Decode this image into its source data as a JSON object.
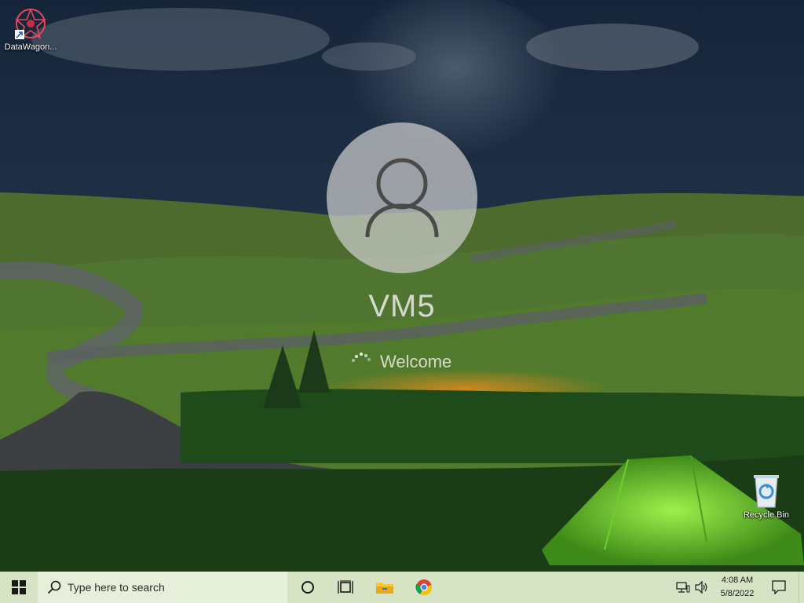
{
  "desktop": {
    "icons": [
      {
        "label": "DataWagon...",
        "icon": "datawagon-app-icon"
      },
      {
        "label": "Recycle Bin",
        "icon": "recycle-bin-icon"
      }
    ]
  },
  "lock_screen": {
    "username": "VM5",
    "status": "Welcome"
  },
  "taskbar": {
    "start_icon": "windows-logo-icon",
    "search_placeholder": "Type here to search",
    "pinned": [
      {
        "name": "cortana",
        "icon": "circle-icon"
      },
      {
        "name": "task-view",
        "icon": "task-view-icon"
      },
      {
        "name": "file-explorer",
        "icon": "folder-icon"
      },
      {
        "name": "chrome",
        "icon": "chrome-icon"
      }
    ],
    "tray": {
      "network_icon": "network-icon",
      "volume_icon": "speaker-icon",
      "time": "4:08 AM",
      "date": "5/8/2022",
      "notification_icon": "notification-icon"
    }
  },
  "colors": {
    "taskbar": "#d7e3c5",
    "search_box": "#e6efd9",
    "tent": "#7fd83a",
    "sky": "#1b2d44"
  }
}
